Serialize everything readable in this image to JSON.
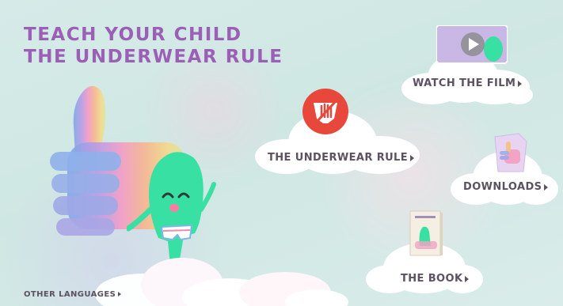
{
  "headline": {
    "line1": "TEACH YOUR CHILD",
    "line2": "THE UNDERWEAR RULE"
  },
  "nav": {
    "watch_film": "WATCH THE FILM",
    "underwear_rule": "THE UNDERWEAR RULE",
    "downloads": "DOWNLOADS",
    "the_book": "THE BOOK",
    "other_languages": "OTHER LANGUAGES"
  },
  "colors": {
    "headline": "#9b5fb5",
    "label_text": "#5b5160",
    "rule_badge": "#e8483c",
    "character": "#39e0a4",
    "background": "#d3e9e6"
  },
  "icons": {
    "film": "play-icon",
    "rule": "stop-hand-icon",
    "downloads": "thumbs-up-document-icon",
    "book": "book-icon",
    "arrow": "arrow-right-icon"
  }
}
